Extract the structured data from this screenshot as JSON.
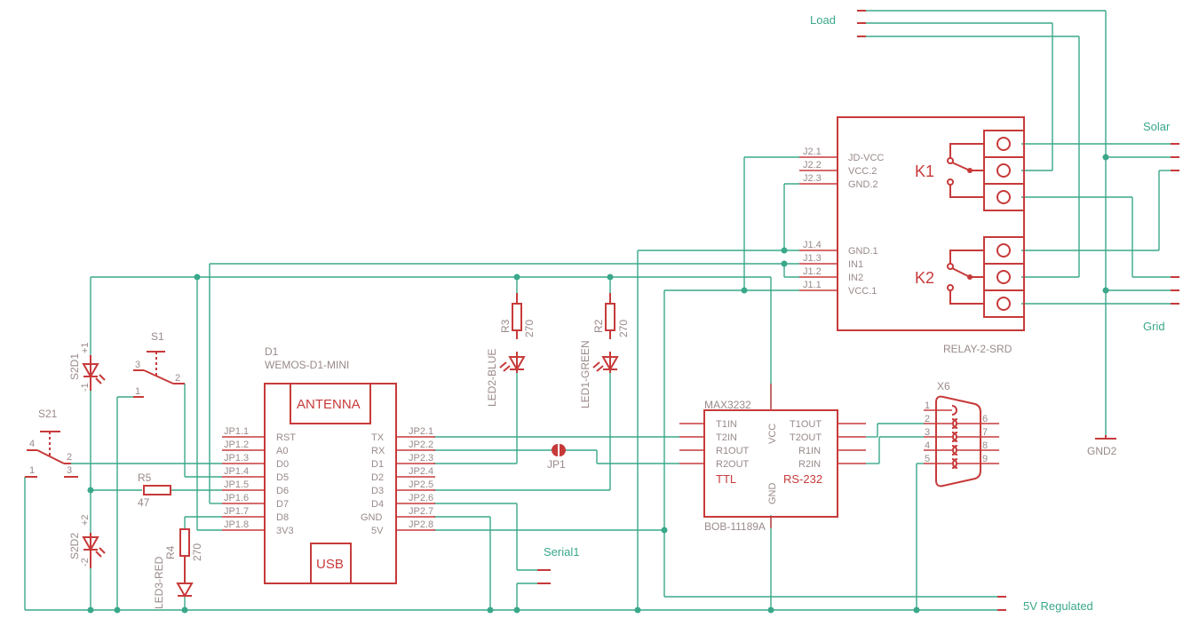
{
  "nets": {
    "load": "Load",
    "solar": "Solar",
    "grid": "Grid",
    "serial1": "Serial1",
    "regulated": "5V Regulated",
    "gnd2": "GND2"
  },
  "d1": {
    "ref": "D1",
    "value": "WEMOS-D1-MINI",
    "antenna": "ANTENNA",
    "usb": "USB",
    "jp1_pins": [
      "JP1.1",
      "JP1.2",
      "JP1.3",
      "JP1.4",
      "JP1.5",
      "JP1.6",
      "JP1.7",
      "JP1.8"
    ],
    "jp1_names": [
      "RST",
      "A0",
      "D0",
      "D5",
      "D6",
      "D7",
      "D8",
      "3V3"
    ],
    "jp2_pins": [
      "JP2.1",
      "JP2.2",
      "JP2.3",
      "JP2.4",
      "JP2.5",
      "JP2.6",
      "JP2.7",
      "JP2.8"
    ],
    "jp2_names": [
      "TX",
      "RX",
      "D1",
      "D2",
      "D3",
      "D4",
      "GND",
      "5V"
    ]
  },
  "relay": {
    "value": "RELAY-2-SRD",
    "k1": "K1",
    "k2": "K2",
    "j2_pins": [
      "J2.1",
      "J2.2",
      "J2.3"
    ],
    "j2_names": [
      "JD-VCC",
      "VCC.2",
      "GND.2"
    ],
    "j1_pins": [
      "J1.4",
      "J1.3",
      "J1.2",
      "J1.1"
    ],
    "j1_names": [
      "GND.1",
      "IN1",
      "IN2",
      "VCC.1"
    ]
  },
  "max": {
    "ref": "MAX3232",
    "value": "BOB-11189A",
    "left": [
      "T1IN",
      "T2IN",
      "R1OUT",
      "R2OUT"
    ],
    "right": [
      "T1OUT",
      "T2OUT",
      "R1IN",
      "R2IN"
    ],
    "vcc": "VCC",
    "gnd": "GND",
    "ttl": "TTL",
    "rs232": "RS-232"
  },
  "x6": {
    "ref": "X6",
    "left": [
      "1",
      "2",
      "3",
      "4",
      "5"
    ],
    "right": [
      "6",
      "7",
      "8",
      "9"
    ]
  },
  "passives": {
    "r3": "R3",
    "r3v": "270",
    "r2": "R2",
    "r2v": "270",
    "r4": "R4",
    "r4v": "270",
    "r5": "R5",
    "r5v": "47",
    "led2": "LED2-BLUE",
    "led1": "LED1-GREEN",
    "led3": "LED3-RED",
    "s2d1": "S2D1",
    "s2d2": "S2D2",
    "s1": "S1",
    "s21": "S21",
    "jp1": "JP1",
    "plus": "+1",
    "minus": "-1",
    "plus2": "+2",
    "minus2": "-2",
    "pin1": "1",
    "pin2": "2",
    "pin3": "3",
    "pin4": "4"
  },
  "colors": {
    "wire": "#3aa88a",
    "part": "#c73a3a",
    "label": "#9a8a8a"
  }
}
